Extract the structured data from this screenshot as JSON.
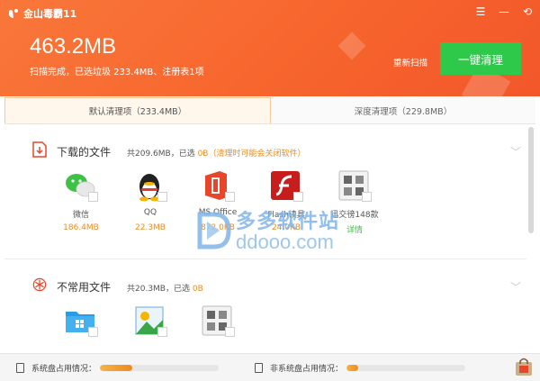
{
  "app": {
    "title": "金山毒霸11",
    "window_controls": [
      "☰",
      "—",
      "⟲"
    ]
  },
  "summary": {
    "total_size": "463.2MB",
    "scan_info": "扫描完成，已选垃圾 233.4MB、注册表1项",
    "rescan_label": "重新扫描",
    "clean_button_label": "一键清理"
  },
  "tabs": [
    {
      "label": "默认清理项（233.4MB）",
      "active": true
    },
    {
      "label": "深度清理项（229.8MB）",
      "active": false
    }
  ],
  "sections": [
    {
      "title": "下载的文件",
      "stat_prefix": "共209.6MB，已选 ",
      "stat_selected": "0B",
      "stat_note": "（清理时可能会关闭软件）",
      "items": [
        {
          "name": "微信",
          "size": "186.4MB",
          "icon": "wechat-icon"
        },
        {
          "name": "QQ",
          "size": "22.3MB",
          "icon": "qq-icon"
        },
        {
          "name": "MS Office",
          "size": "872.0KB",
          "icon": "office-icon"
        },
        {
          "name": "Flash读具",
          "size": "24.0KB",
          "icon": "flash-icon"
        },
        {
          "name": "迅交徬148款",
          "size": "详情",
          "icon": "apps-grid-icon"
        }
      ]
    },
    {
      "title": "不常用文件",
      "stat_prefix": "共20.3MB，已选 ",
      "stat_selected": "0B",
      "stat_note": "",
      "items": [
        {
          "name": "",
          "size": "",
          "icon": "folder-icon"
        },
        {
          "name": "",
          "size": "",
          "icon": "image-icon"
        },
        {
          "name": "",
          "size": "",
          "icon": "apps-grid-icon"
        }
      ]
    }
  ],
  "watermark": {
    "cn": "多多软件站",
    "en": "ddooo.com"
  },
  "footer": {
    "system_disk_label": "系统盘占用情况：",
    "system_disk_usage": 0.27,
    "non_system_disk_label": "非系统盘占用情况：",
    "non_system_disk_usage": 0.1
  },
  "colors": {
    "header": "#f7652d",
    "clean_button": "#2ec84a",
    "highlight": "#f08a1c"
  }
}
